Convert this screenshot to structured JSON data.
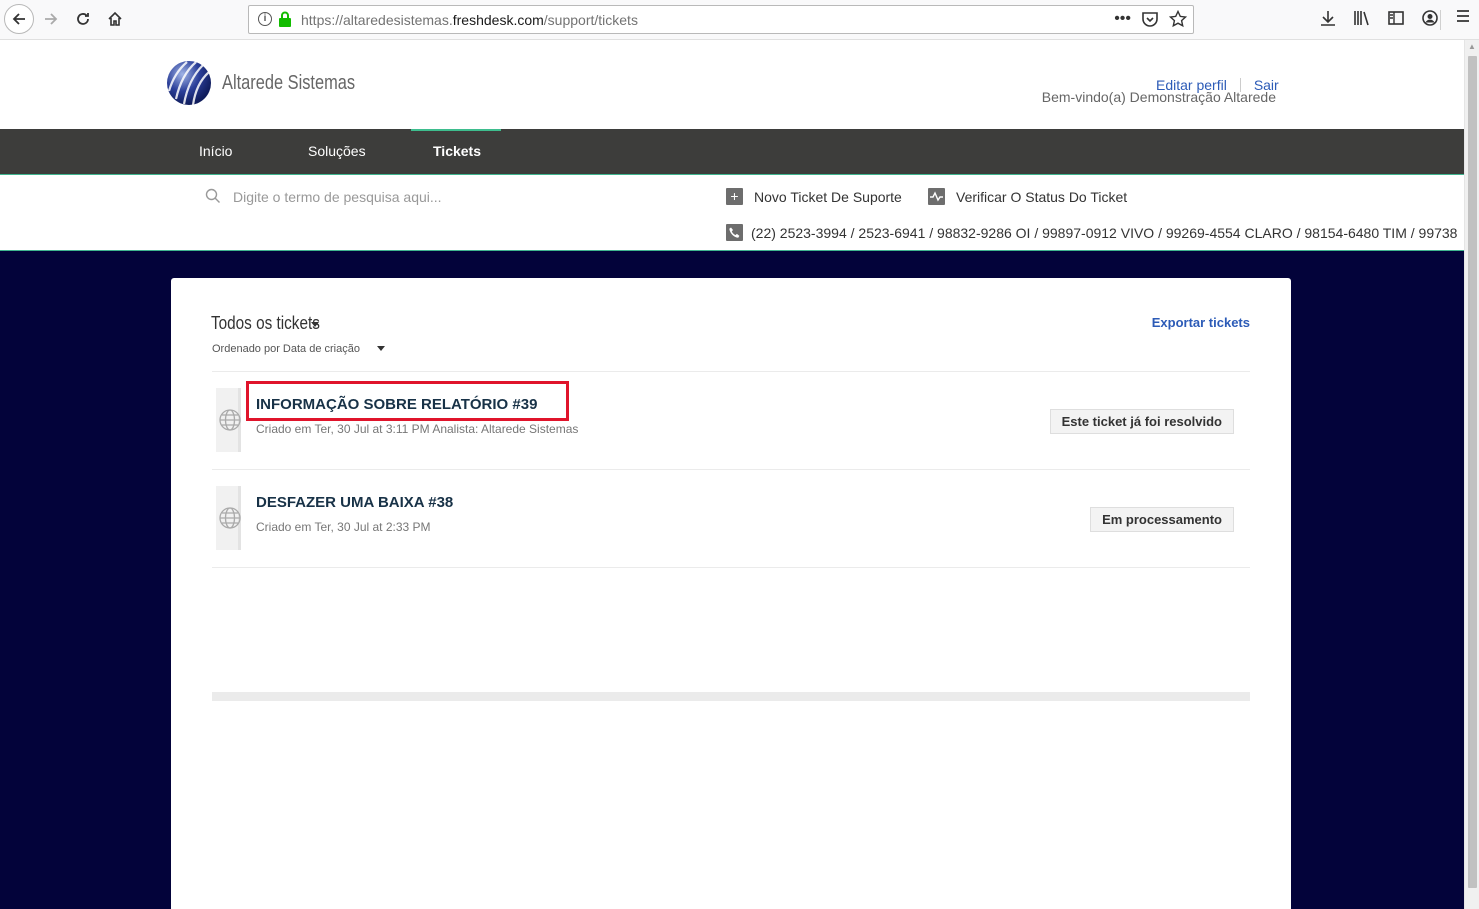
{
  "browser": {
    "url_prefix": "https://altaredesistemas.",
    "url_domain": "freshdesk.com",
    "url_path": "/support/tickets"
  },
  "header": {
    "company_name": "Altarede Sistemas",
    "welcome": "Bem-vindo(a) Demonstração Altarede",
    "edit_profile": "Editar perfil",
    "logout": "Sair"
  },
  "nav": {
    "items": [
      "Início",
      "Soluções",
      "Tickets"
    ],
    "active": "Tickets"
  },
  "search": {
    "placeholder": "Digite o termo de pesquisa aqui..."
  },
  "actions": {
    "new_ticket": "Novo Ticket De Suporte",
    "check_status": "Verificar O Status Do Ticket",
    "phones": "(22) 2523-3994 / 2523-6941 / 98832-9286 OI / 99897-0912 VIVO / 99269-4554 CLARO / 98154-6480 TIM / 99738"
  },
  "tickets_page": {
    "filter_label": "Todos os tickets",
    "sort_label": "Ordenado por Data de criação",
    "export_label": "Exportar tickets",
    "tickets": [
      {
        "title": "INFORMAÇÃO SOBRE RELATÓRIO #39",
        "meta": "Criado em Ter, 30 Jul at 3:11 PM Analista: Altarede Sistemas",
        "status": "Este ticket já foi resolvido"
      },
      {
        "title": "DESFAZER UMA BAIXA #38",
        "meta": "Criado em Ter, 30 Jul at 2:33 PM",
        "status": "Em processamento"
      }
    ]
  },
  "colors": {
    "nav_bg": "#3d3d3b",
    "accent_green": "#3ebd8e",
    "link_blue": "#2c5bb7",
    "page_bg": "#03033a",
    "highlight_red": "#e0142b"
  }
}
